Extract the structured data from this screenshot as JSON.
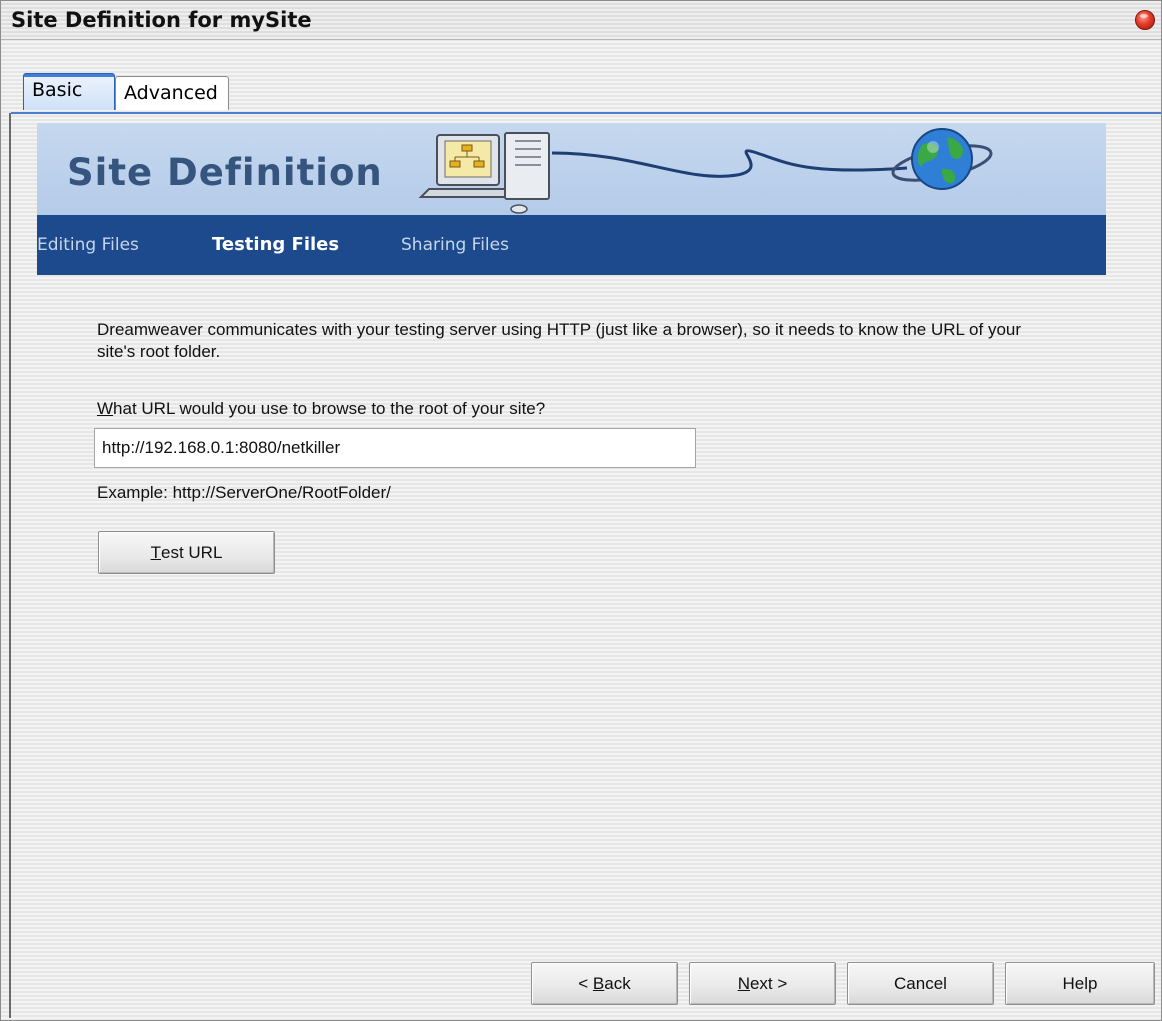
{
  "window": {
    "title": "Site Definition for mySite"
  },
  "tabs": [
    {
      "label": "Basic",
      "active": true
    },
    {
      "label": "Advanced",
      "active": false
    }
  ],
  "banner": {
    "title": "Site Definition"
  },
  "steps": [
    {
      "label": "Editing Files",
      "current": false
    },
    {
      "label": "Testing Files",
      "current": true
    },
    {
      "label": "Sharing Files",
      "current": false
    }
  ],
  "content": {
    "description": "Dreamweaver communicates with your testing server using HTTP (just like a browser), so it needs to know the URL of your site's root folder.",
    "question_mnemonic": "W",
    "question_rest": "hat URL would you use to browse to the root of your site?",
    "url_value": "http://192.168.0.1:8080/netkiller",
    "example": "Example: http://ServerOne/RootFolder/",
    "test_button_mnemonic": "T",
    "test_button_rest": "est URL"
  },
  "footer": {
    "back_prefix": "< ",
    "back_mnemonic": "B",
    "back_rest": "ack",
    "next_mnemonic": "N",
    "next_rest": "ext >",
    "cancel_label": "Cancel",
    "help_label": "Help"
  },
  "colors": {
    "banner_bg": "#c6d8ef",
    "banner_title": "#35557f",
    "subnav_bg": "#1c4a8c",
    "tab_accent": "#3f7fd6",
    "close_button": "#e33a28"
  },
  "icons": [
    "close-icon",
    "computer-icon",
    "globe-icon"
  ]
}
